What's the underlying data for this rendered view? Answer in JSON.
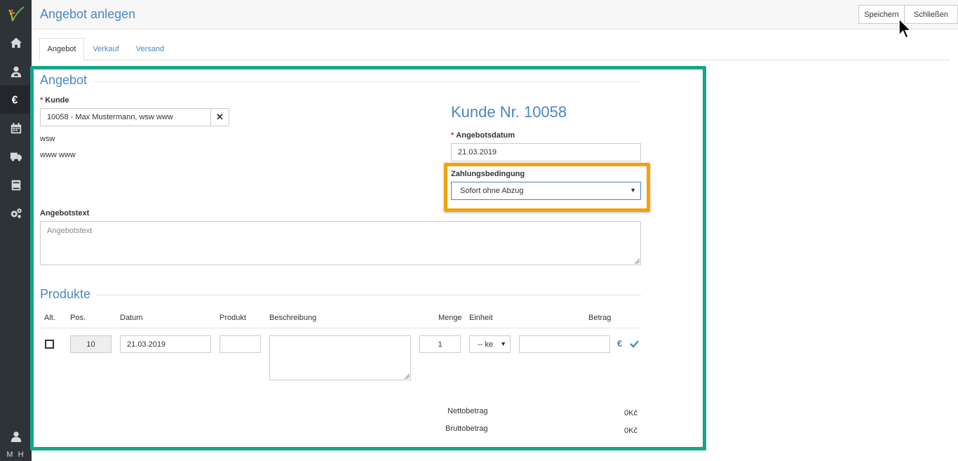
{
  "sidebar": {
    "nav": [
      "home-icon",
      "contacts-icon",
      "euro-icon",
      "calendar-icon",
      "truck-icon",
      "book-icon",
      "cogs-icon"
    ],
    "active": "euro-icon",
    "user_initials": "M H"
  },
  "header": {
    "title": "Angebot anlegen",
    "save_label": "Speichern",
    "close_label": "Schließen"
  },
  "tabs": [
    {
      "label": "Angebot",
      "active": true
    },
    {
      "label": "Verkauf",
      "active": false
    },
    {
      "label": "Versand",
      "active": false
    }
  ],
  "offer": {
    "section_title": "Angebot",
    "customer_label": "Kunde",
    "customer_value": "10058 - Max  Mustermann, wsw www",
    "clear_glyph": "✕",
    "address_line1": "wsw",
    "address_line2": "www www",
    "customer_number_title": "Kunde Nr. 10058",
    "date_label": "Angebotsdatum",
    "date_value": "21.03.2019",
    "payment_label": "Zahlungsbedingung",
    "payment_value": "Sofort ohne Abzug",
    "text_label": "Angebotstext",
    "text_placeholder": "Angebotstext",
    "required_marker": "*"
  },
  "products": {
    "section_title": "Produkte",
    "columns": {
      "alt": "Alt.",
      "pos": "Pos.",
      "date": "Datum",
      "product": "Produkt",
      "description": "Beschreibung",
      "quantity": "Menge",
      "unit": "Einheit",
      "amount": "Betrag"
    },
    "row": {
      "pos": "10",
      "date": "21.03.2019",
      "product": "",
      "description": "",
      "quantity": "1",
      "unit": "-- ke",
      "amount": "",
      "euro_glyph": "€"
    }
  },
  "totals": {
    "net_label": "Nettobetrag",
    "net_value": "0Kč",
    "gross_label": "Bruttobetrag",
    "gross_value": "0Kč"
  },
  "colors": {
    "accent": "#4a87c2",
    "sidebar_bg": "#2e3338",
    "highlight_green": "#13a689",
    "highlight_orange": "#f0a40a",
    "required": "#c0392b"
  }
}
